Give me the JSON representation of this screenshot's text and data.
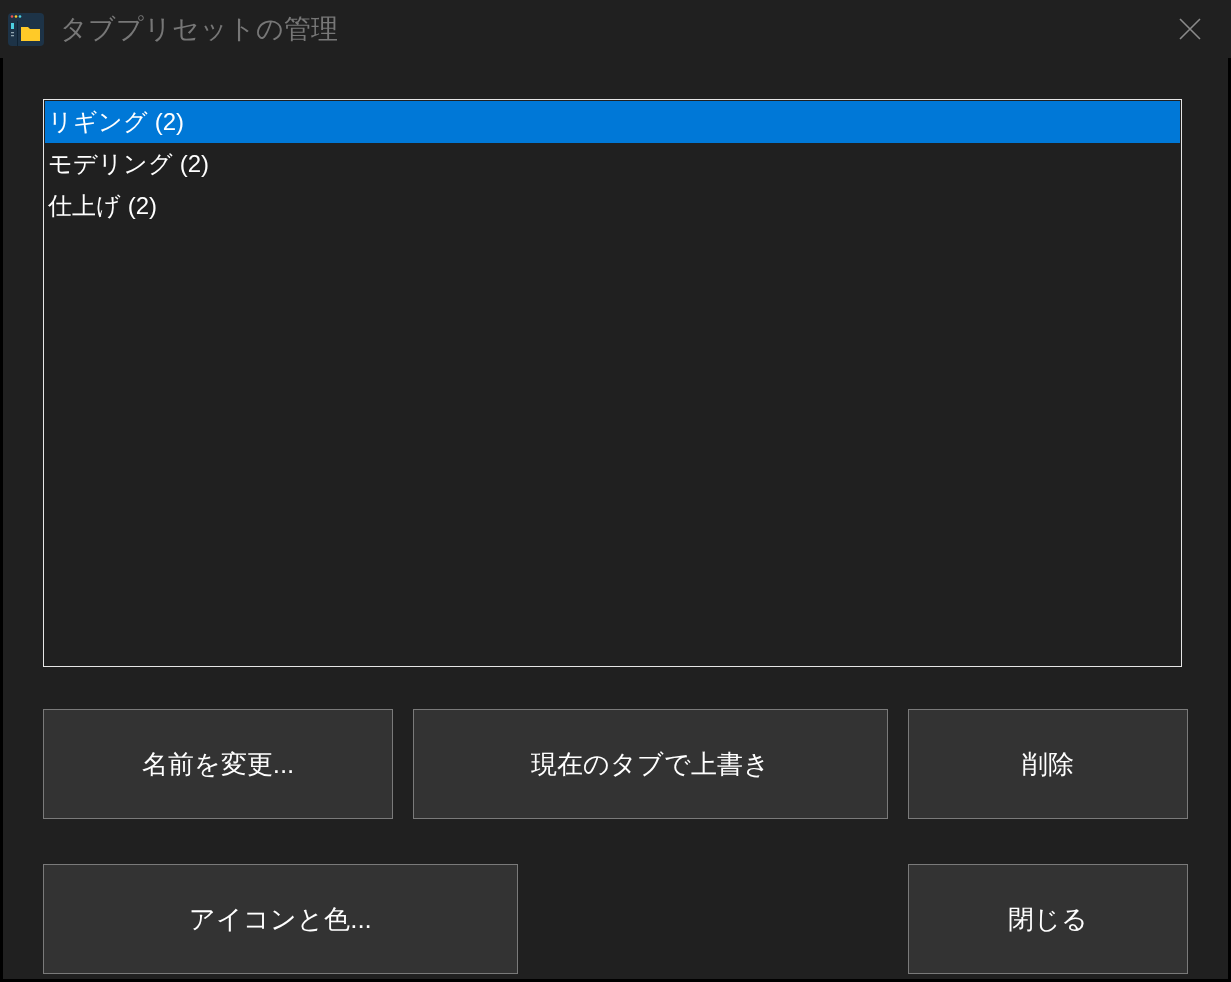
{
  "window": {
    "title": "タブプリセットの管理"
  },
  "presets": [
    {
      "label": "リギング (2)",
      "selected": true
    },
    {
      "label": "モデリング (2)",
      "selected": false
    },
    {
      "label": "仕上げ (2)",
      "selected": false
    }
  ],
  "button_rows": [
    [
      {
        "label": "名前を変更..."
      },
      {
        "label": "現在のタブで上書き"
      },
      {
        "label": "削除"
      }
    ],
    [
      {
        "label": "アイコンと色..."
      },
      {
        "label": "閉じる"
      }
    ]
  ]
}
